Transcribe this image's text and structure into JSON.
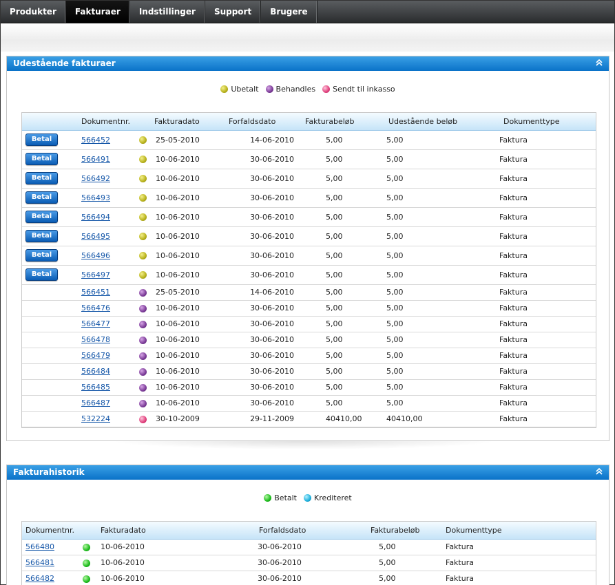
{
  "nav": {
    "items": [
      "Produkter",
      "Fakturaer",
      "Indstillinger",
      "Support",
      "Brugere"
    ],
    "active_index": 1
  },
  "outstanding": {
    "title": "Udestående fakturaer",
    "legend": [
      {
        "label": "Ubetalt",
        "color": "yellow"
      },
      {
        "label": "Behandles",
        "color": "purple"
      },
      {
        "label": "Sendt til inkasso",
        "color": "pink"
      }
    ],
    "columns": [
      "",
      "Dokumentnr.",
      "",
      "Fakturadato",
      "Forfaldsdato",
      "Fakturabeløb",
      "Udestående beløb",
      "Dokumenttype"
    ],
    "pay_label": "Betal",
    "rows": [
      {
        "pay": true,
        "doc": "566452",
        "status": "yellow",
        "date": "25-05-2010",
        "due": "14-06-2010",
        "amount": "5,00",
        "outstanding": "5,00",
        "type": "Faktura"
      },
      {
        "pay": true,
        "doc": "566491",
        "status": "yellow",
        "date": "10-06-2010",
        "due": "30-06-2010",
        "amount": "5,00",
        "outstanding": "5,00",
        "type": "Faktura"
      },
      {
        "pay": true,
        "doc": "566492",
        "status": "yellow",
        "date": "10-06-2010",
        "due": "30-06-2010",
        "amount": "5,00",
        "outstanding": "5,00",
        "type": "Faktura"
      },
      {
        "pay": true,
        "doc": "566493",
        "status": "yellow",
        "date": "10-06-2010",
        "due": "30-06-2010",
        "amount": "5,00",
        "outstanding": "5,00",
        "type": "Faktura"
      },
      {
        "pay": true,
        "doc": "566494",
        "status": "yellow",
        "date": "10-06-2010",
        "due": "30-06-2010",
        "amount": "5,00",
        "outstanding": "5,00",
        "type": "Faktura"
      },
      {
        "pay": true,
        "doc": "566495",
        "status": "yellow",
        "date": "10-06-2010",
        "due": "30-06-2010",
        "amount": "5,00",
        "outstanding": "5,00",
        "type": "Faktura"
      },
      {
        "pay": true,
        "doc": "566496",
        "status": "yellow",
        "date": "10-06-2010",
        "due": "30-06-2010",
        "amount": "5,00",
        "outstanding": "5,00",
        "type": "Faktura"
      },
      {
        "pay": true,
        "doc": "566497",
        "status": "yellow",
        "date": "10-06-2010",
        "due": "30-06-2010",
        "amount": "5,00",
        "outstanding": "5,00",
        "type": "Faktura"
      },
      {
        "pay": false,
        "doc": "566451",
        "status": "purple",
        "date": "25-05-2010",
        "due": "14-06-2010",
        "amount": "5,00",
        "outstanding": "5,00",
        "type": "Faktura"
      },
      {
        "pay": false,
        "doc": "566476",
        "status": "purple",
        "date": "10-06-2010",
        "due": "30-06-2010",
        "amount": "5,00",
        "outstanding": "5,00",
        "type": "Faktura"
      },
      {
        "pay": false,
        "doc": "566477",
        "status": "purple",
        "date": "10-06-2010",
        "due": "30-06-2010",
        "amount": "5,00",
        "outstanding": "5,00",
        "type": "Faktura"
      },
      {
        "pay": false,
        "doc": "566478",
        "status": "purple",
        "date": "10-06-2010",
        "due": "30-06-2010",
        "amount": "5,00",
        "outstanding": "5,00",
        "type": "Faktura"
      },
      {
        "pay": false,
        "doc": "566479",
        "status": "purple",
        "date": "10-06-2010",
        "due": "30-06-2010",
        "amount": "5,00",
        "outstanding": "5,00",
        "type": "Faktura"
      },
      {
        "pay": false,
        "doc": "566484",
        "status": "purple",
        "date": "10-06-2010",
        "due": "30-06-2010",
        "amount": "5,00",
        "outstanding": "5,00",
        "type": "Faktura"
      },
      {
        "pay": false,
        "doc": "566485",
        "status": "purple",
        "date": "10-06-2010",
        "due": "30-06-2010",
        "amount": "5,00",
        "outstanding": "5,00",
        "type": "Faktura"
      },
      {
        "pay": false,
        "doc": "566487",
        "status": "purple",
        "date": "10-06-2010",
        "due": "30-06-2010",
        "amount": "5,00",
        "outstanding": "5,00",
        "type": "Faktura"
      },
      {
        "pay": false,
        "doc": "532224",
        "status": "pink",
        "date": "30-10-2009",
        "due": "29-11-2009",
        "amount": "40410,00",
        "outstanding": "40410,00",
        "type": "Faktura"
      }
    ]
  },
  "history": {
    "title": "Fakturahistorik",
    "legend": [
      {
        "label": "Betalt",
        "color": "green"
      },
      {
        "label": "Krediteret",
        "color": "blue"
      }
    ],
    "columns": [
      "Dokumentnr.",
      "",
      "Fakturadato",
      "Forfaldsdato",
      "Fakturabeløb",
      "Dokumenttype"
    ],
    "rows": [
      {
        "doc": "566480",
        "status": "green",
        "date": "10-06-2010",
        "due": "30-06-2010",
        "amount": "5,00",
        "type": "Faktura"
      },
      {
        "doc": "566481",
        "status": "green",
        "date": "10-06-2010",
        "due": "30-06-2010",
        "amount": "5,00",
        "type": "Faktura"
      },
      {
        "doc": "566482",
        "status": "green",
        "date": "10-06-2010",
        "due": "30-06-2010",
        "amount": "5,00",
        "type": "Faktura"
      }
    ]
  },
  "colors": {
    "header_blue": "#0a72c8",
    "nav_dark": "#2a2c2e",
    "link": "#1456a8"
  },
  "icons": {
    "collapse": "double-chevron-up-icon",
    "pay": "betal-button"
  }
}
